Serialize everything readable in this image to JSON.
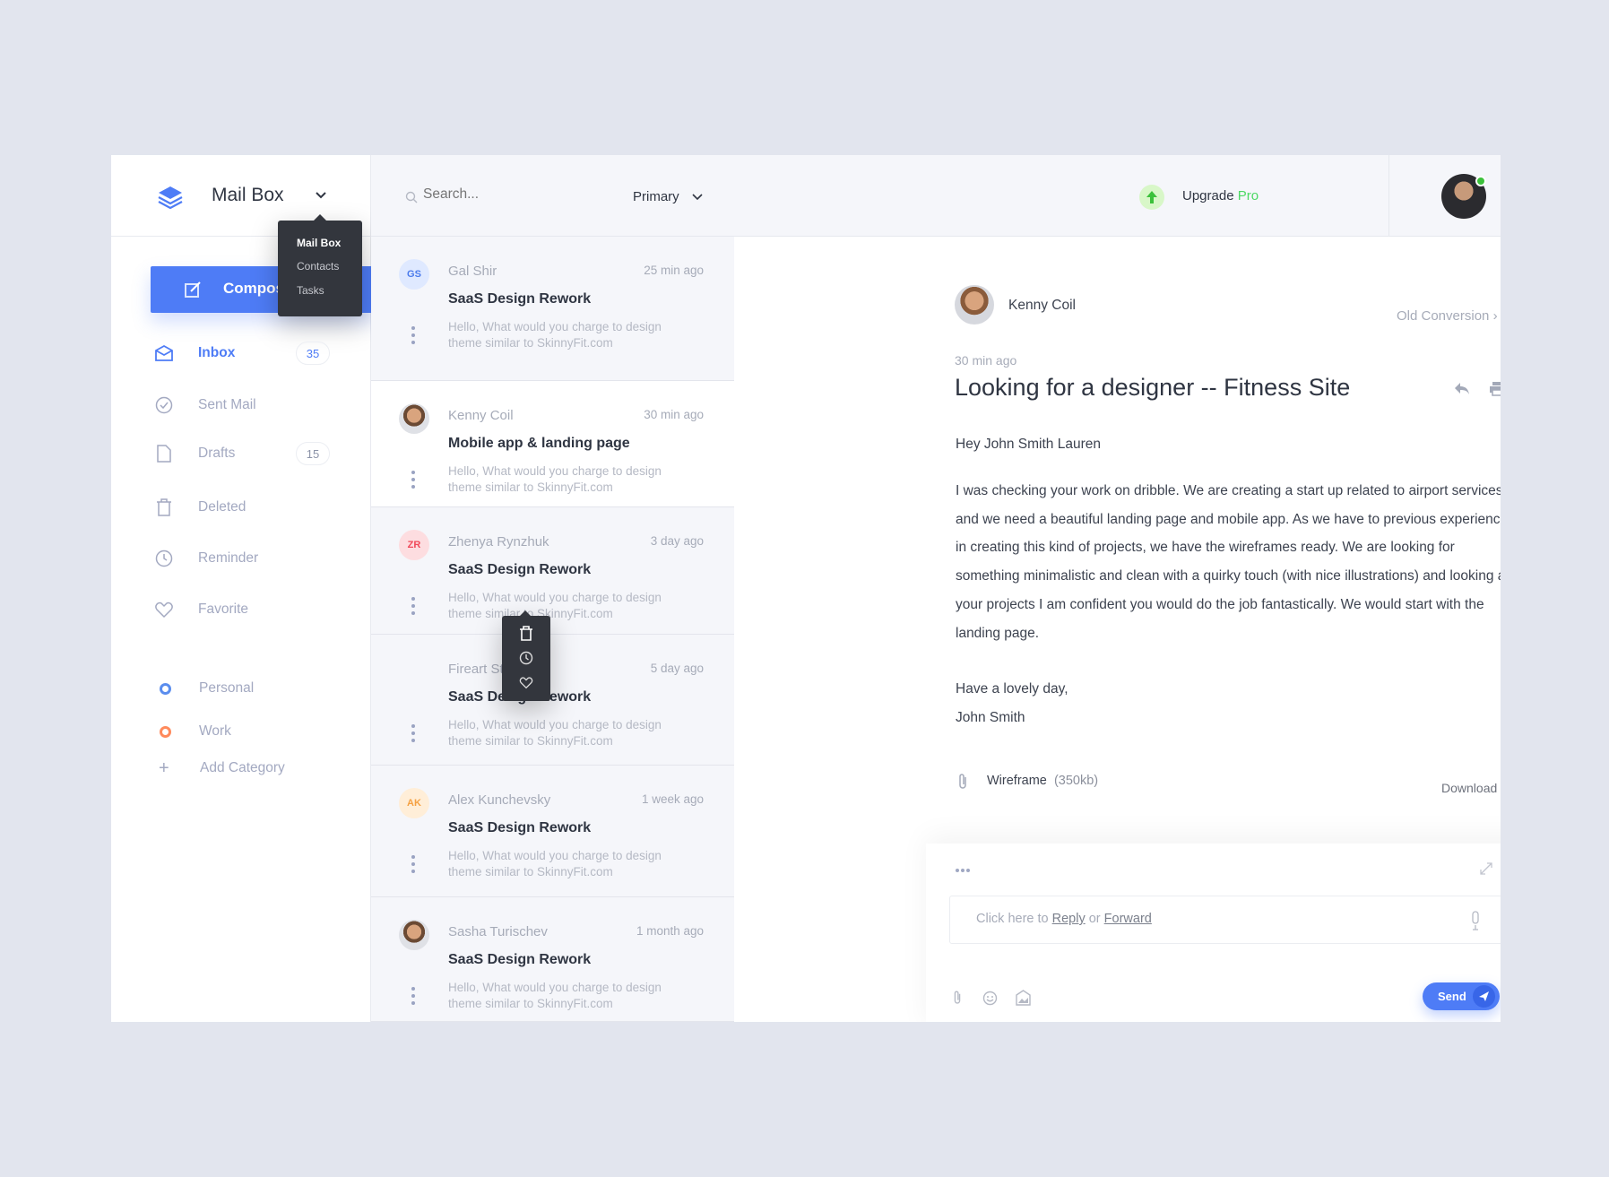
{
  "sidebar": {
    "app_title": "Mail Box",
    "app_menu": [
      "Mail Box",
      "Contacts",
      "Tasks"
    ],
    "compose_label": "Compose",
    "items": [
      {
        "label": "Inbox",
        "badge": "35",
        "icon": "envelope-icon",
        "active": true
      },
      {
        "label": "Sent Mail",
        "icon": "check-circle-icon"
      },
      {
        "label": "Drafts",
        "badge": "15",
        "icon": "file-icon"
      },
      {
        "label": "Deleted",
        "icon": "trash-icon"
      },
      {
        "label": "Reminder",
        "icon": "clock-icon"
      },
      {
        "label": "Favorite",
        "icon": "heart-icon"
      }
    ],
    "categories": [
      {
        "label": "Personal",
        "color": "#5a8dee"
      },
      {
        "label": "Work",
        "color": "#ff8a5c"
      }
    ],
    "add_category": "Add Category"
  },
  "list": {
    "search_placeholder": "Search...",
    "filter": "Primary",
    "row_actions": [
      "trash-icon",
      "clock-icon",
      "heart-icon"
    ],
    "emails": [
      {
        "initials": "GS",
        "sender": "Gal Shir",
        "time": "25 min ago",
        "subject": "SaaS Design Rework",
        "preview": "Hello, What would you charge to design theme similar to SkinnyFit.com",
        "avatar_bg": "#dfe9ff",
        "avatar_fg": "#4b7bec"
      },
      {
        "initials": "",
        "sender": "Kenny Coil",
        "time": "30 min ago",
        "subject": "Mobile app & landing page",
        "preview": "Hello, What would you charge to design theme similar to SkinnyFit.com",
        "photo": true
      },
      {
        "initials": "ZR",
        "sender": "Zhenya Rynzhuk",
        "time": "3 day ago",
        "subject": "SaaS Design Rework",
        "preview": "Hello, What would you charge to design theme similar to SkinnyFit.com",
        "avatar_bg": "#fddde0",
        "avatar_fg": "#f04a5a"
      },
      {
        "initials": "",
        "sender": "Fireart Studio",
        "time": "5 day ago",
        "subject": "SaaS Design Rework",
        "preview": "Hello, What would you charge to design theme similar to SkinnyFit.com"
      },
      {
        "initials": "AK",
        "sender": "Alex Kunchevsky",
        "time": "1 week ago",
        "subject": "SaaS Design Rework",
        "preview": "Hello, What would you charge to design theme similar to SkinnyFit.com",
        "avatar_bg": "#ffeed8",
        "avatar_fg": "#f5a142"
      },
      {
        "initials": "",
        "sender": "Sasha Turischev",
        "time": "1 month ago",
        "subject": "SaaS Design Rework",
        "preview": "Hello, What would you charge to design theme similar to SkinnyFit.com",
        "photo": true
      }
    ]
  },
  "header": {
    "upgrade": "Upgrade",
    "pro": "Pro",
    "accent": "#4cd964"
  },
  "message": {
    "sender": "Kenny Coil",
    "old_conversion": "Old Conversion",
    "time": "30 min ago",
    "title": "Looking for a designer -- Fitness Site",
    "greeting": "Hey John Smith Lauren",
    "body": "I was checking your work on dribble. We are creating a start up related to airport services and we need a beautiful landing page and mobile app. As we have to previous experience in creating this kind of projects, we have the wireframes ready. We are looking for something minimalistic and clean with a quirky touch (with nice illustrations) and looking at your projects I am confident you would do the job fantastically. We would start with the landing page.",
    "signoff": "Have a lovely day,",
    "signature": "John Smith",
    "attachment": {
      "name": "Wireframe",
      "size": "(350kb)",
      "download": "Download"
    }
  },
  "reply": {
    "prefix": "Click here to",
    "reply": "Reply",
    "or": "or",
    "forward": "Forward",
    "send": "Send"
  },
  "colors": {
    "primary": "#4e7cf6",
    "dark": "#33363d"
  }
}
